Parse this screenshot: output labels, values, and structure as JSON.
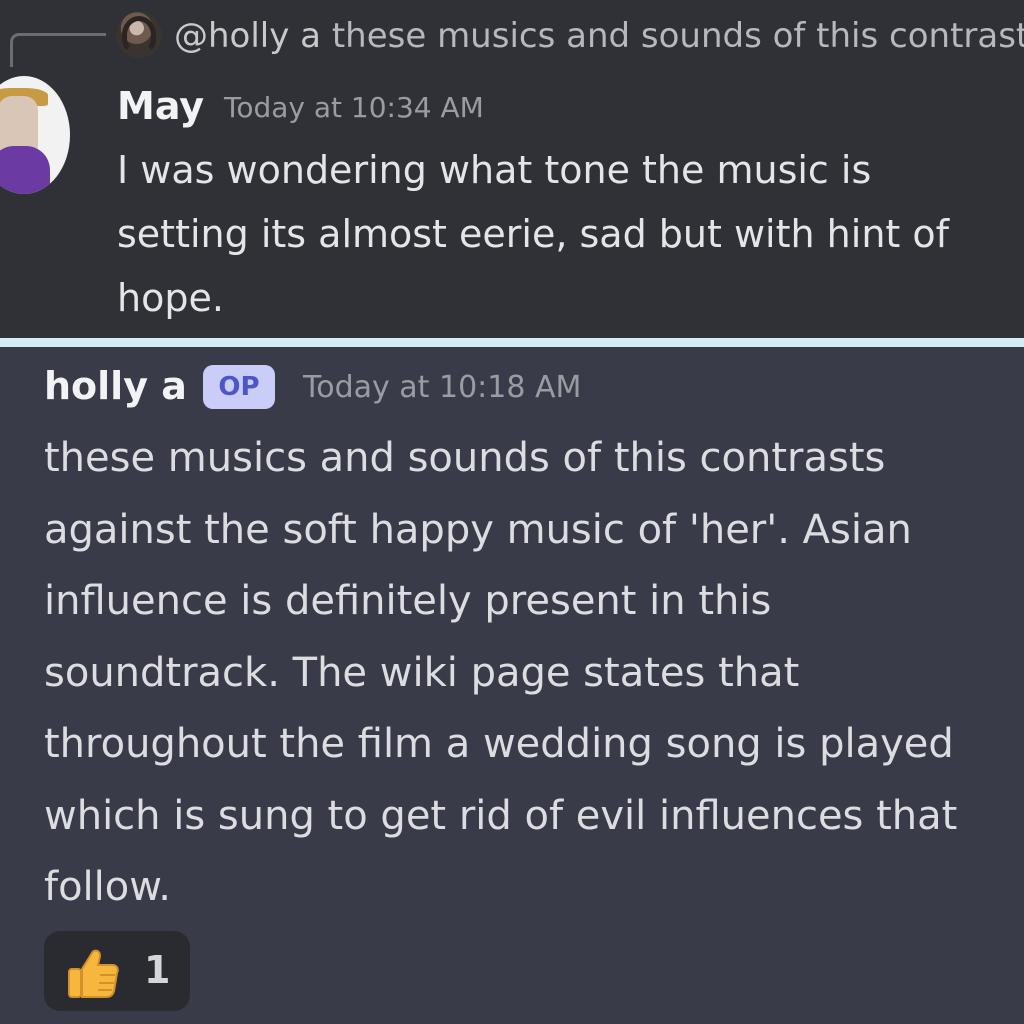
{
  "reply": {
    "mention": "@holly a",
    "preview": "these musics and sounds of this contrast"
  },
  "may_message": {
    "author": "May",
    "timestamp": "Today at 10:34 AM",
    "text": "I was wondering what tone the music is setting its almost eerie, sad but with hint of hope."
  },
  "holly_message": {
    "author": "holly a",
    "badge": "OP",
    "timestamp": "Today at 10:18 AM",
    "text": "these musics and sounds of this contrasts\nagainst the soft happy music of 'her'. Asian\ninfluence is definitely present in this\nsoundtrack. The wiki page states that\nthroughout the film a wedding song is played\nwhich is sung to get rid of evil influences that\nfollow."
  },
  "reaction": {
    "emoji": "thumbs-up-icon",
    "count": "1"
  },
  "colors": {
    "top_bg": "#303136",
    "bottom_bg": "#393b48",
    "badge_bg": "#c9cdf7",
    "badge_text": "#4d56c8"
  }
}
